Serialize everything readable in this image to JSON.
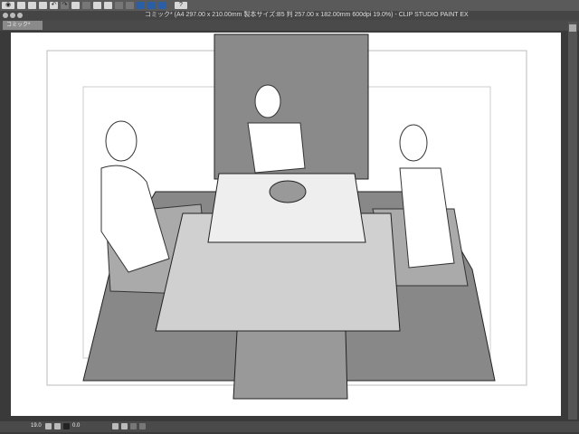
{
  "window": {
    "title": "コミック* (A4 297.00 x 210.00mm 製本サイズ:B5 判 257.00 x 182.00mm 600dpi 19.0%)  - CLIP STUDIO PAINT EX"
  },
  "tab": {
    "label": "コミック*"
  },
  "toolbar": {
    "items": [
      "eye-icon",
      "new-icon",
      "open-icon",
      "save-icon",
      "undo-icon",
      "redo-icon",
      "selection-icon",
      "fill-icon",
      "transform-icon",
      "ruler-icon",
      "help-icon"
    ],
    "help_label": "?"
  },
  "status": {
    "zoom": "19.0",
    "angle": "0.0"
  }
}
